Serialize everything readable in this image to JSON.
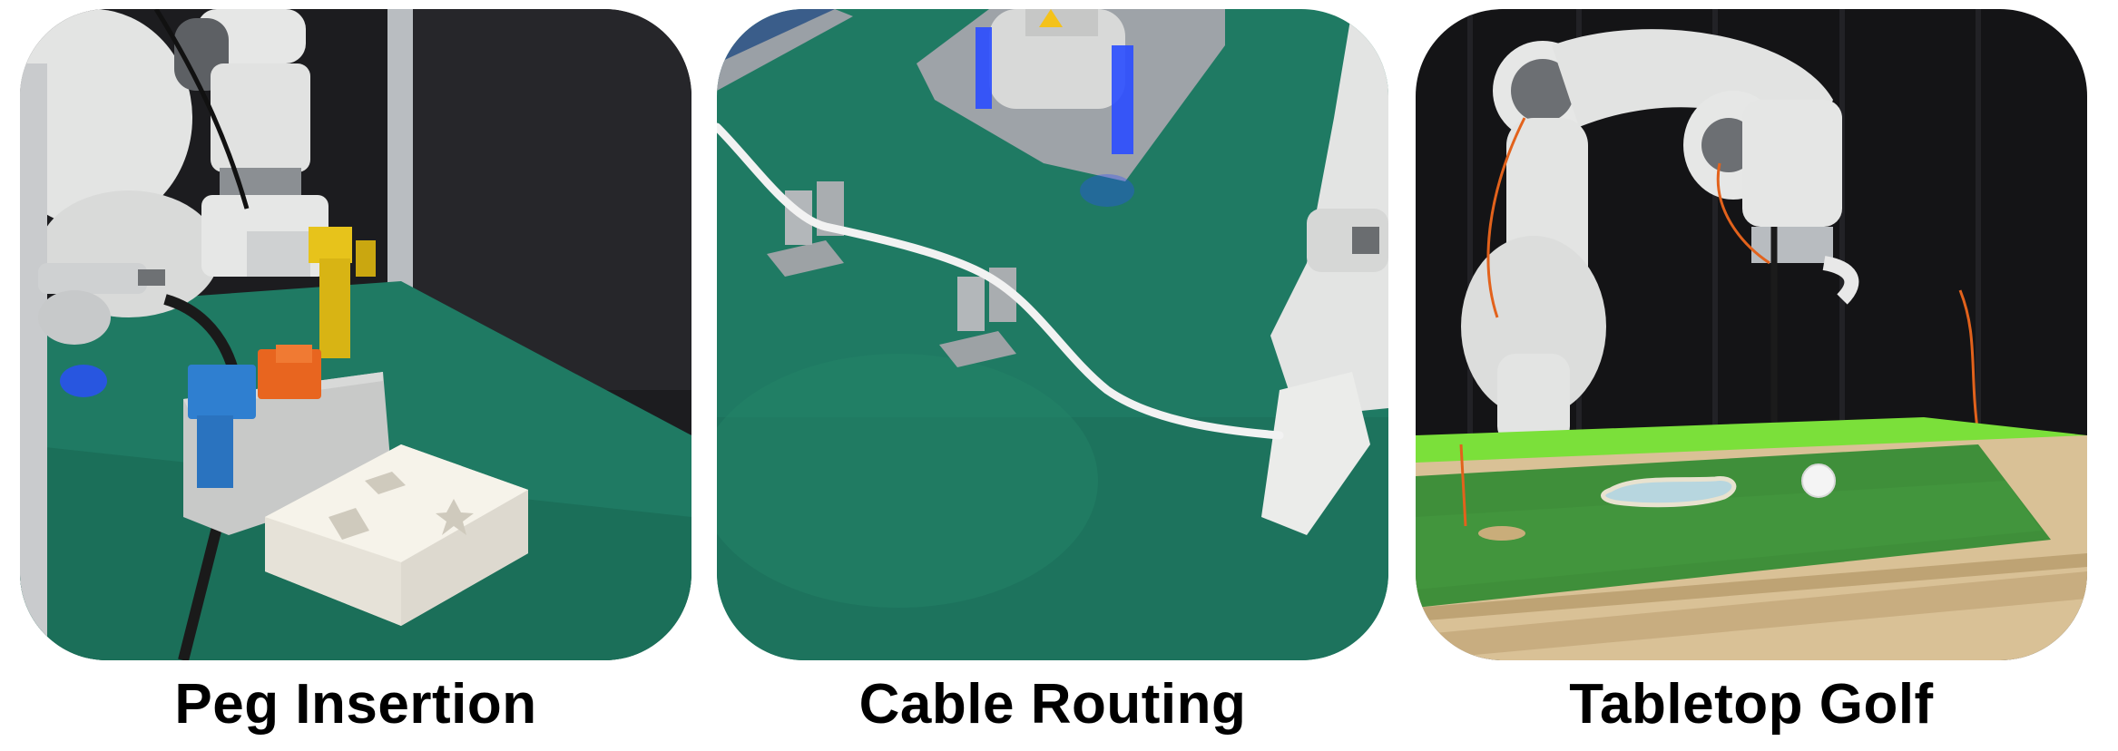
{
  "panels": [
    {
      "caption": "Peg Insertion"
    },
    {
      "caption": "Cable Routing"
    },
    {
      "caption": "Tabletop Golf"
    }
  ],
  "colors": {
    "background": "#ffffff",
    "caption_text": "#000000",
    "table_green": "#1f7a63",
    "turf_green": "#3f8f3a",
    "backdrop": "#1c1c1f",
    "robot_white": "#e6e7e6",
    "peg_yellow": "#e7c31b",
    "peg_orange": "#e8651f",
    "peg_blue": "#2f7fd0",
    "led_blue": "#2a4dff"
  }
}
